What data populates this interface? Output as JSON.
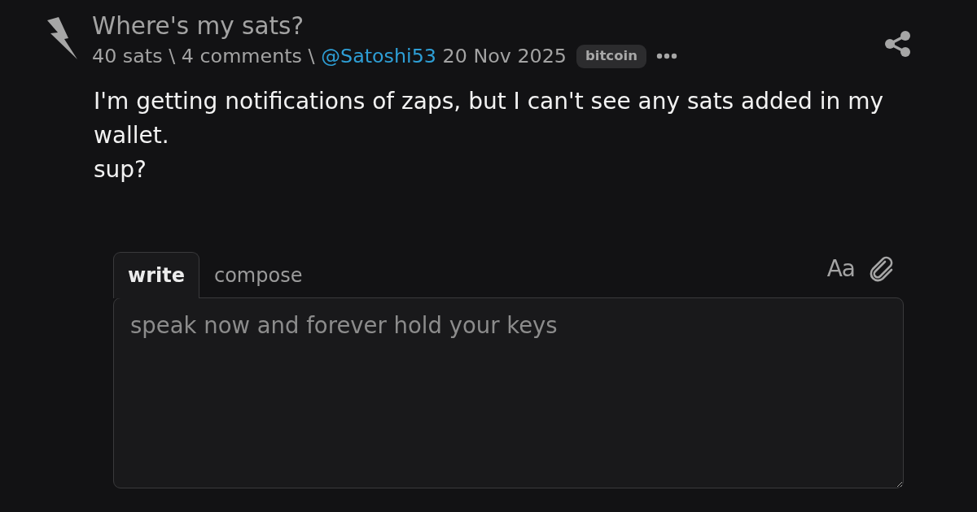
{
  "post": {
    "title": "Where's my sats?",
    "meta": [
      {
        "kind": "text",
        "text": "40 sats"
      },
      {
        "kind": "sep",
        "text": "\\"
      },
      {
        "kind": "text",
        "text": "4 comments"
      },
      {
        "kind": "sep",
        "text": "\\"
      },
      {
        "kind": "user",
        "text": "@Satoshi53"
      },
      {
        "kind": "text",
        "text": "20 Nov 2025"
      },
      {
        "kind": "tag",
        "text": "bitcoin"
      }
    ],
    "body": [
      "I'm getting notifications of zaps, but I can't see any sats added in my wallet.",
      "sup?"
    ]
  },
  "editor": {
    "tabs": [
      {
        "label": "write",
        "selected": true
      },
      {
        "label": "compose",
        "selected": false
      }
    ],
    "format_button": "Aa",
    "placeholder": "speak now and forever hold your keys"
  }
}
